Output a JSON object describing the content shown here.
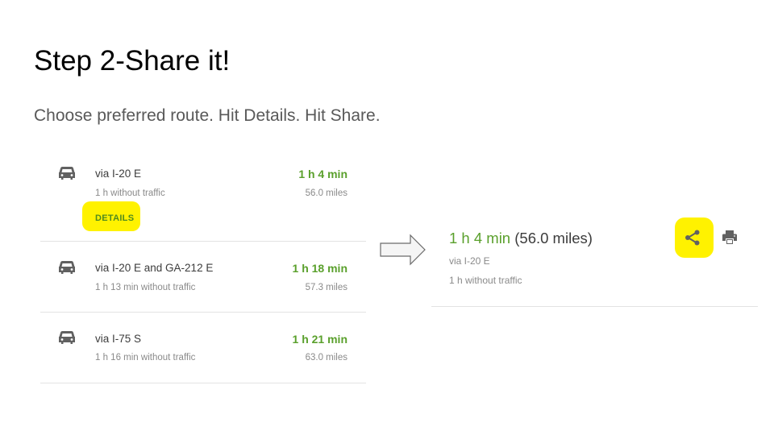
{
  "slide": {
    "title": "Step 2-Share it!",
    "subtitle": "Choose preferred route. Hit Details. Hit Share."
  },
  "routes": [
    {
      "via": "via I-20 E",
      "traffic": "1 h without traffic",
      "time": "1 h 4 min",
      "distance": "56.0 miles",
      "details_label": "DETAILS"
    },
    {
      "via": "via I-20 E and GA-212 E",
      "traffic": "1 h 13 min without traffic",
      "time": "1 h 18 min",
      "distance": "57.3 miles"
    },
    {
      "via": "via I-75 S",
      "traffic": "1 h 16 min without traffic",
      "time": "1 h 21 min",
      "distance": "63.0 miles"
    }
  ],
  "detail": {
    "time": "1 h 4 min",
    "distance": "(56.0 miles)",
    "via": "via I-20 E",
    "traffic": "1 h without traffic"
  },
  "icons": {
    "route": "car-icon",
    "share": "share-icon",
    "print": "print-icon",
    "flow": "right-arrow-icon"
  },
  "colors": {
    "time_green": "#5aa02c",
    "highlight_yellow": "#fff200",
    "icon_gray": "#616161"
  }
}
